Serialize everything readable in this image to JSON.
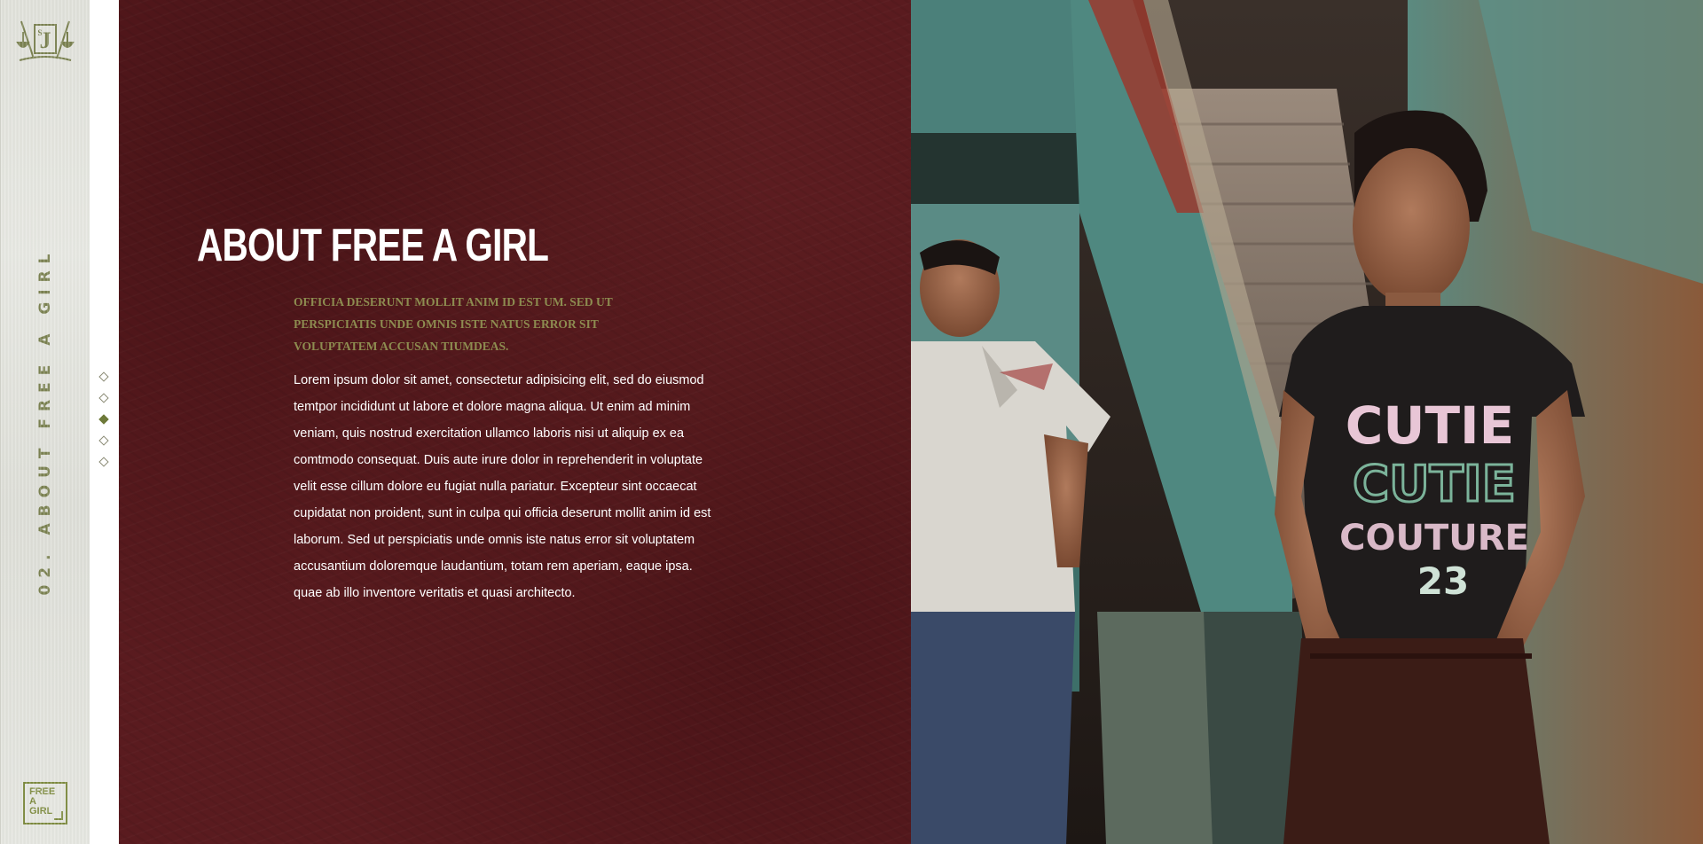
{
  "sidebar": {
    "logo_top_icon": "justice-scales-sj-logo-icon",
    "section_title": "02. ABOUT FREE A GIRL",
    "logo_bottom": {
      "line1": "FREE",
      "line2": "A",
      "line3": "GIRL"
    }
  },
  "pagination": {
    "count": 5,
    "active_index": 2
  },
  "content": {
    "heading": "ABOUT FREE A GIRL",
    "lead": "OFFICIA DESERUNT MOLLIT ANIM ID EST UM. SED UT PERSPICIATIS UNDE OMNIS ISTE NATUS ERROR SIT VOLUPTATEM ACCUSAN TIUMDEAS.",
    "body": "Lorem ipsum dolor sit amet, consectetur adipisicing elit, sed do eiusmod temtpor incididunt ut labore et dolore magna aliqua. Ut enim ad minim veniam, quis nostrud exercitation ullamco laboris nisi ut aliquip ex ea comtmodo consequat. Duis aute irure dolor in reprehenderit in voluptate velit esse cillum dolore eu fugiat nulla pariatur. Excepteur sint occaecat cupidatat non proident, sunt in culpa qui officia deserunt mollit anim id est laborum. Sed ut perspiciatis unde omnis iste natus error sit voluptatem accusantium doloremque laudantium, totam rem aperiam, eaque ipsa. quae ab illo inventore veritatis et quasi architecto."
  },
  "photo": {
    "shirt_text_line1": "CUTIE",
    "shirt_text_line2": "CUTIE",
    "shirt_text_line3": "COUTURE",
    "shirt_number": "23"
  },
  "colors": {
    "panel_red": "#5a1b1f",
    "olive_accent": "#7a8150",
    "lead_text": "#8d8c50"
  }
}
